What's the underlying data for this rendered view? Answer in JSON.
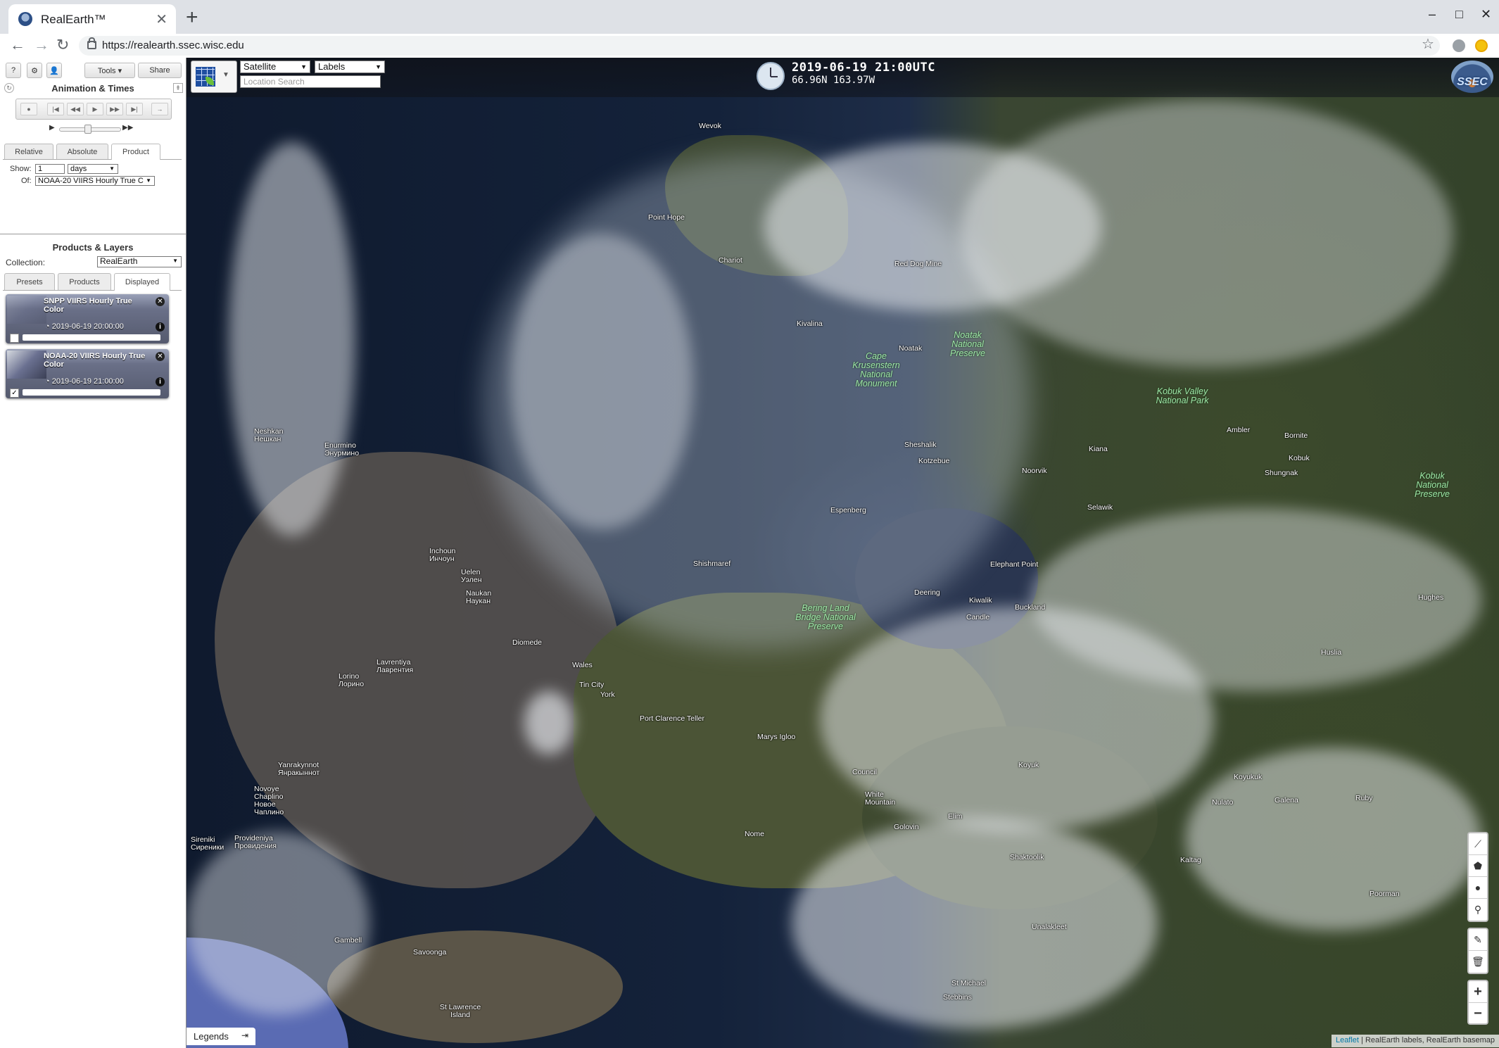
{
  "browser": {
    "tab_title": "RealEarth™",
    "tab_close": "✕",
    "new_tab": "+",
    "url": "https://realearth.ssec.wisc.edu",
    "controls": {
      "minimize": "–",
      "maximize": "□",
      "close": "✕"
    }
  },
  "panel": {
    "toolbar": {
      "help": "?",
      "settings": "⚙",
      "user": "👤",
      "tools": "Tools ▾",
      "share": "Share"
    },
    "animation_title": "Animation & Times",
    "time_tabs": [
      "Relative",
      "Absolute",
      "Product"
    ],
    "show_label": "Show:",
    "show_value": "1",
    "show_unit": "days",
    "of_label": "Of:",
    "of_value": "NOAA-20 VIIRS Hourly True C",
    "products_title": "Products & Layers",
    "collection_label": "Collection:",
    "collection_value": "RealEarth",
    "layer_tabs": [
      "Presets",
      "Products",
      "Displayed"
    ],
    "layers": [
      {
        "name": "SNPP VIIRS Hourly True Color",
        "time": "2019-06-19 20:00:00",
        "checked": ""
      },
      {
        "name": "NOAA-20 VIIRS Hourly True Color",
        "time": "2019-06-19 21:00:00",
        "checked": "✓"
      }
    ]
  },
  "map": {
    "basemap": "Satellite",
    "overlay": "Labels",
    "search_placeholder": "Location Search",
    "timestamp": "2019-06-19 21:00UTC",
    "coordinates": "66.96N 163.97W",
    "logo": "SSEC",
    "legends": "Legends",
    "attribution_link": "Leaflet",
    "attribution": " | RealEarth labels, RealEarth basemap",
    "zoom_in": "+",
    "zoom_out": "−",
    "places": [
      "Wevok",
      "Point Hope",
      "Chariot",
      "Red Dog Mine",
      "Kivalina",
      "Noatak",
      "Noatak National Preserve",
      "Cape Krusenstern National Monument",
      "Kobuk Valley National Park",
      "Ambler",
      "Bornite",
      "Kobuk",
      "Shungnak",
      "Kiana",
      "Noorvik",
      "Sheshalik",
      "Kotzebue",
      "Selawik",
      "Kobuk National Preserve",
      "Neshkan Нешкан",
      "Enurmino Энурмино",
      "Inchoun Инчоун",
      "Uelen Уэлен",
      "Naukan Наукан",
      "Espenberg",
      "Shishmaref",
      "Elephant Point",
      "Deering",
      "Kiwalik",
      "Buckland",
      "Candle",
      "Bering Land Bridge National Preserve",
      "Diomede",
      "Wales",
      "Tin City",
      "York",
      "Port Clarence Teller",
      "Lavrentiya Лаврентия",
      "Lorino Лорино",
      "Yanrakynnot Янракыннот",
      "Novoye Chaplino Новое Чаплино",
      "Provideniya Провидения",
      "Sireniki Сиреники",
      "Marys Igloo",
      "Council",
      "White Mountain",
      "Golovin",
      "Elim",
      "Nome",
      "Koyuk",
      "Koyukuk",
      "Nulato",
      "Galena",
      "Ruby",
      "Huslia",
      "Hughes",
      "Kaltag",
      "Poorman",
      "Shaktoolik",
      "Unalakleet",
      "St Michael",
      "Stebbins",
      "Gambell",
      "Savoonga",
      "St Lawrence Island"
    ]
  }
}
